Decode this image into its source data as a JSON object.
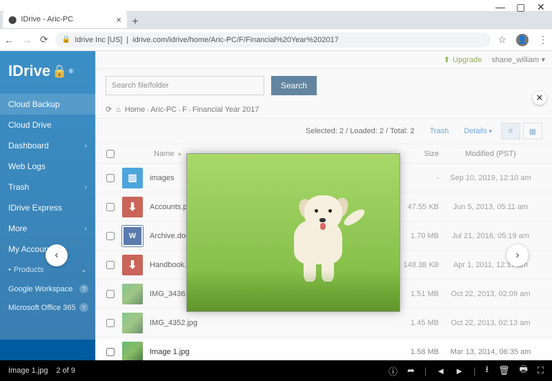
{
  "window": {
    "tab_title": "IDrive - Aric-PC"
  },
  "addr": {
    "secure_label": "Idrive Inc [US]",
    "url": "idrive.com/idrive/home/Aric-PC/F/Financial%20Year%202017"
  },
  "topstrip": {
    "upgrade": "Upgrade",
    "user": "shane_william"
  },
  "logo": {
    "text": "IDrive"
  },
  "sidebar": {
    "items": [
      {
        "label": "Cloud Backup",
        "expandable": false,
        "active": true
      },
      {
        "label": "Cloud Drive",
        "expandable": false
      },
      {
        "label": "Dashboard",
        "expandable": true
      },
      {
        "label": "Web Logs",
        "expandable": false
      },
      {
        "label": "Trash",
        "expandable": true
      },
      {
        "label": "IDrive Express",
        "expandable": false
      },
      {
        "label": "More",
        "expandable": true
      },
      {
        "label": "My Account",
        "expandable": false
      }
    ],
    "products_header": "Products",
    "products": [
      {
        "label": "Google Workspace"
      },
      {
        "label": "Microsoft Office 365"
      }
    ]
  },
  "search": {
    "placeholder": "Search file/folder",
    "button": "Search"
  },
  "breadcrumb": [
    "Home",
    "Aric-PC",
    "F",
    "Financial Year 2017"
  ],
  "counts_text": "Selected: 2 / Loaded: 2 / Total: 2",
  "actions": {
    "trash": "Trash",
    "details": "Details"
  },
  "columns": {
    "name": "Name",
    "size": "Size",
    "modified": "Modified (PST)"
  },
  "rows": [
    {
      "icon": "folder",
      "name": "images",
      "size": "-",
      "modified": "Sep 10, 2019, 12:10 am"
    },
    {
      "icon": "pdf",
      "name": "Accounts.pdf",
      "size": "47.55 KB",
      "modified": "Jun 5, 2013, 05:11 am"
    },
    {
      "icon": "word",
      "name": "Archive.docx",
      "size": "1.70 MB",
      "modified": "Jul 21, 2016, 05:19 am"
    },
    {
      "icon": "pdf",
      "name": "Handbook.pdf",
      "size": "148.38 KB",
      "modified": "Apr 1, 2011, 12:17 am"
    },
    {
      "icon": "img",
      "name": "IMG_3436.jpg",
      "size": "1.51 MB",
      "modified": "Oct 22, 2013, 02:09 am"
    },
    {
      "icon": "img",
      "name": "IMG_4352.jpg",
      "size": "1.45 MB",
      "modified": "Oct 22, 2013, 02:13 am"
    },
    {
      "icon": "img",
      "name": "Image 1.jpg",
      "size": "1.58 MB",
      "modified": "Mar 13, 2014, 06:35 am"
    }
  ],
  "lightbox": {
    "filename": "Image 1.jpg",
    "counter": "2 of 9"
  }
}
